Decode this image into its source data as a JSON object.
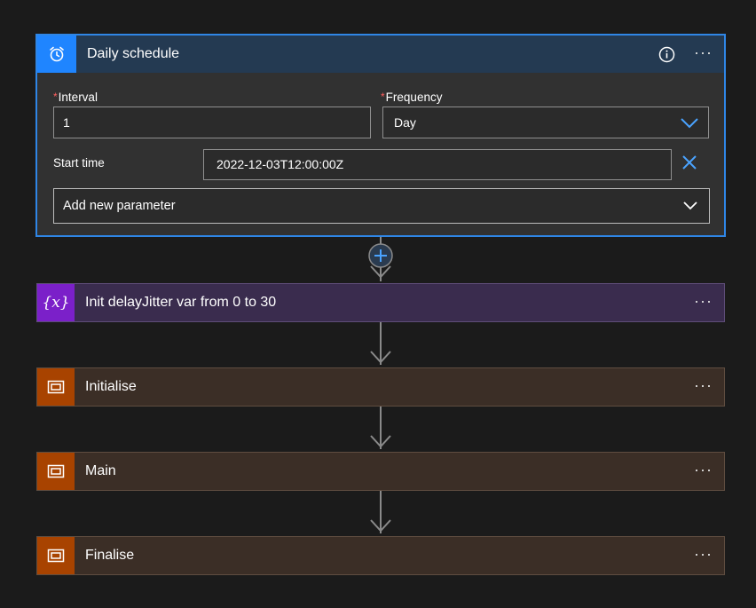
{
  "trigger": {
    "title": "Daily schedule",
    "icon": "alarm-clock-icon",
    "interval": {
      "label": "Interval",
      "required_mark": "*",
      "value": "1"
    },
    "frequency": {
      "label": "Frequency",
      "required_mark": "*",
      "value": "Day"
    },
    "start_time": {
      "label": "Start time",
      "value": "2022-12-03T12:00:00Z"
    },
    "add_parameter": "Add new parameter",
    "more": "···"
  },
  "actions": [
    {
      "title": "Init delayJitter var from 0 to 30",
      "icon_text": "{x}",
      "icon": "variable-icon",
      "more": "···"
    },
    {
      "title": "Initialise",
      "icon": "scope-icon",
      "more": "···"
    },
    {
      "title": "Main",
      "icon": "scope-icon",
      "more": "···"
    },
    {
      "title": "Finalise",
      "icon": "scope-icon",
      "more": "···"
    }
  ],
  "colors": {
    "trigger_accent": "#1f85ff",
    "trigger_border": "#2f86e6",
    "variable_accent": "#7b20c9",
    "scope_accent": "#a84300",
    "required": "#ff5f5f",
    "background": "#1b1b1b"
  }
}
